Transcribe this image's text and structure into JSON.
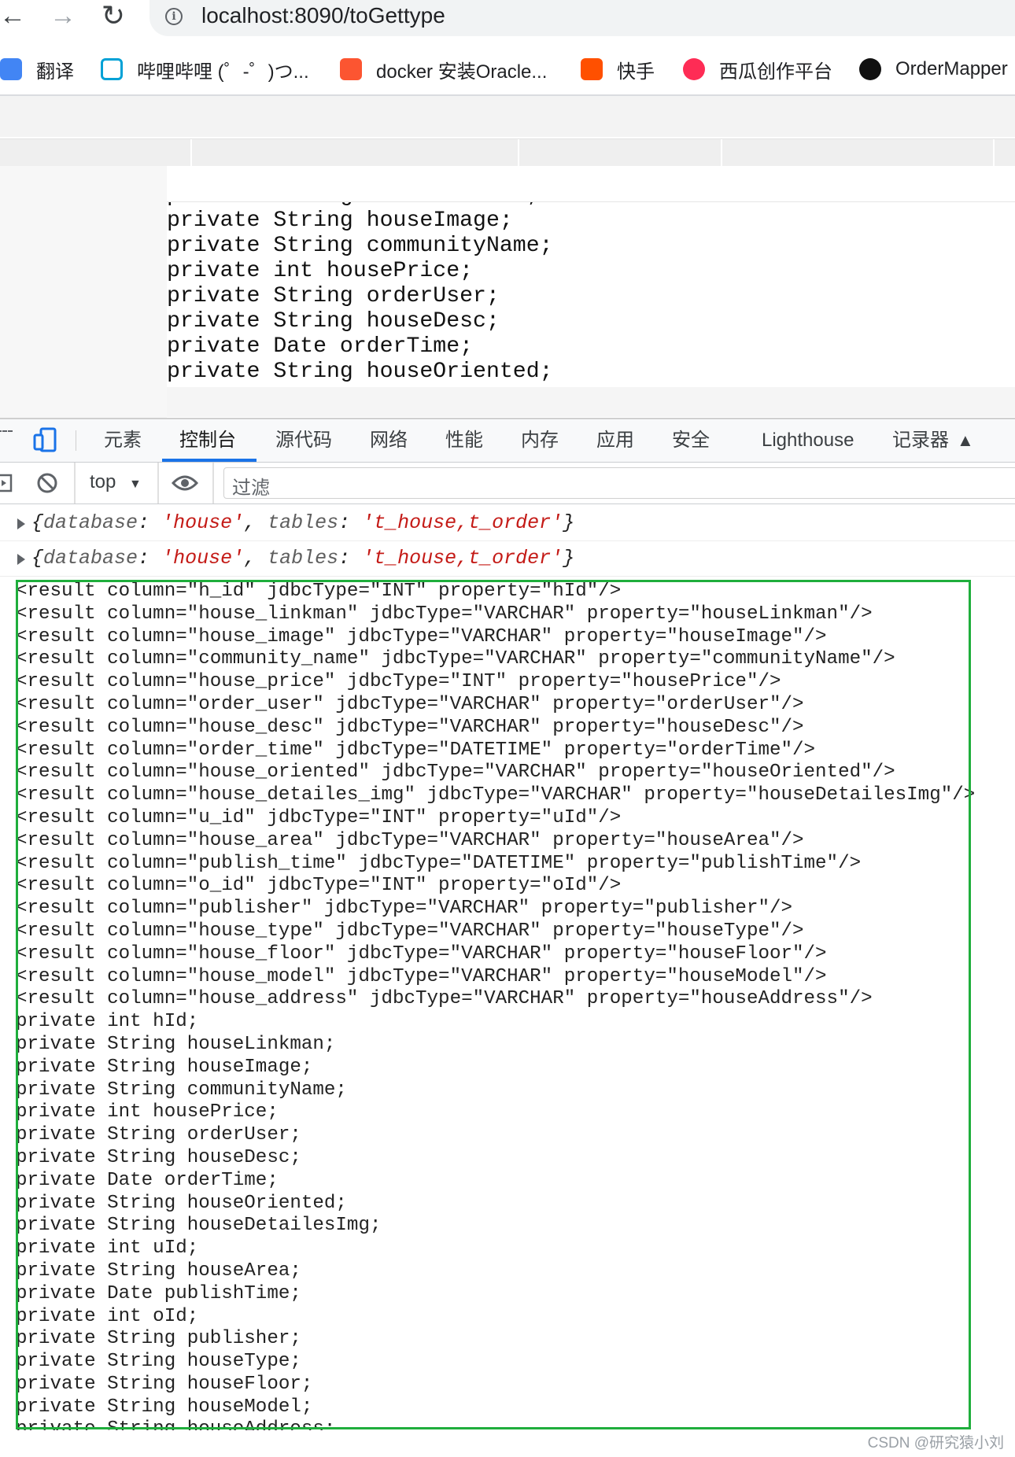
{
  "browser": {
    "url": "localhost:8090/toGettype",
    "bookmarks": [
      {
        "label": "翻译",
        "icon": "google-translate-icon",
        "color": "#4285f4"
      },
      {
        "label": "哔哩哔哩 (゜-゜)つ...",
        "icon": "bilibili-icon",
        "color": "#00a1d6"
      },
      {
        "label": "docker 安装Oracle...",
        "icon": "csdn-icon",
        "color": "#fc5531"
      },
      {
        "label": "快手",
        "icon": "kuaishou-icon",
        "color": "#ff5000"
      },
      {
        "label": "西瓜创作平台",
        "icon": "xigua-icon",
        "color": "#fe2c55"
      },
      {
        "label": "OrderMapper",
        "icon": "github-icon",
        "color": "#000000"
      }
    ]
  },
  "page": {
    "code_text": "private String houseLinkman;\nprivate String houseImage;\nprivate String communityName;\nprivate int housePrice;\nprivate String orderUser;\nprivate String houseDesc;\nprivate Date orderTime;\nprivate String houseOriented;"
  },
  "devtools": {
    "tabs": [
      "元素",
      "控制台",
      "源代码",
      "网络",
      "性能",
      "内存",
      "应用",
      "安全",
      "Lighthouse",
      "记录器"
    ],
    "active_tab": "控制台",
    "context": "top",
    "filter_placeholder": "过滤",
    "logs": [
      {
        "k1": "database",
        "v1": "'house'",
        "k2": "tables",
        "v2": "'t_house,t_order'"
      },
      {
        "k1": "database",
        "v1": "'house'",
        "k2": "tables",
        "v2": "'t_house,t_order'"
      }
    ],
    "result_text": "<result column=\"h_id\" jdbcType=\"INT\" property=\"hId\"/>\n<result column=\"house_linkman\" jdbcType=\"VARCHAR\" property=\"houseLinkman\"/>\n<result column=\"house_image\" jdbcType=\"VARCHAR\" property=\"houseImage\"/>\n<result column=\"community_name\" jdbcType=\"VARCHAR\" property=\"communityName\"/>\n<result column=\"house_price\" jdbcType=\"INT\" property=\"housePrice\"/>\n<result column=\"order_user\" jdbcType=\"VARCHAR\" property=\"orderUser\"/>\n<result column=\"house_desc\" jdbcType=\"VARCHAR\" property=\"houseDesc\"/>\n<result column=\"order_time\" jdbcType=\"DATETIME\" property=\"orderTime\"/>\n<result column=\"house_oriented\" jdbcType=\"VARCHAR\" property=\"houseOriented\"/>\n<result column=\"house_detailes_img\" jdbcType=\"VARCHAR\" property=\"houseDetailesImg\"/>\n<result column=\"u_id\" jdbcType=\"INT\" property=\"uId\"/>\n<result column=\"house_area\" jdbcType=\"VARCHAR\" property=\"houseArea\"/>\n<result column=\"publish_time\" jdbcType=\"DATETIME\" property=\"publishTime\"/>\n<result column=\"o_id\" jdbcType=\"INT\" property=\"oId\"/>\n<result column=\"publisher\" jdbcType=\"VARCHAR\" property=\"publisher\"/>\n<result column=\"house_type\" jdbcType=\"VARCHAR\" property=\"houseType\"/>\n<result column=\"house_floor\" jdbcType=\"VARCHAR\" property=\"houseFloor\"/>\n<result column=\"house_model\" jdbcType=\"VARCHAR\" property=\"houseModel\"/>\n<result column=\"house_address\" jdbcType=\"VARCHAR\" property=\"houseAddress\"/>\nprivate int hId;\nprivate String houseLinkman;\nprivate String houseImage;\nprivate String communityName;\nprivate int housePrice;\nprivate String orderUser;\nprivate String houseDesc;\nprivate Date orderTime;\nprivate String houseOriented;\nprivate String houseDetailesImg;\nprivate int uId;\nprivate String houseArea;\nprivate Date publishTime;\nprivate int oId;\nprivate String publisher;\nprivate String houseType;\nprivate String houseFloor;\nprivate String houseModel;\nprivate String houseAddress;"
  },
  "watermark": "CSDN @研究猿小刘",
  "colors": {
    "highlight_box": "#1fae3c",
    "accent": "#1a73e8",
    "string": "#c41a16"
  }
}
